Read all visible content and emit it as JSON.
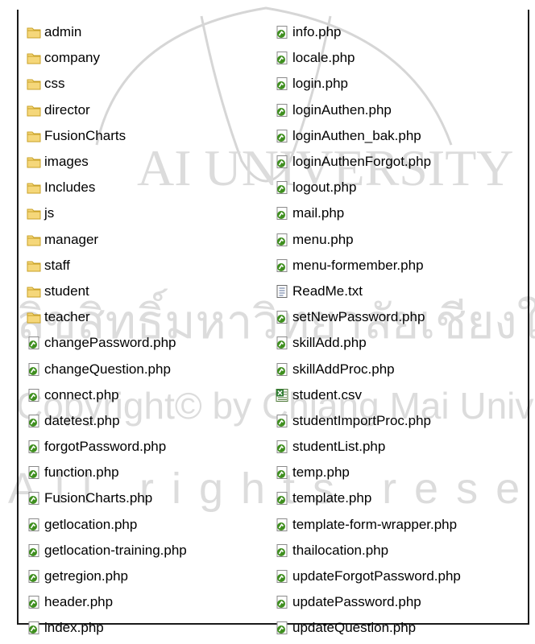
{
  "columns": [
    {
      "items": [
        {
          "name": "admin",
          "icon": "folder-icon"
        },
        {
          "name": "company",
          "icon": "folder-icon"
        },
        {
          "name": "css",
          "icon": "folder-icon"
        },
        {
          "name": "director",
          "icon": "folder-icon"
        },
        {
          "name": "FusionCharts",
          "icon": "folder-icon"
        },
        {
          "name": "images",
          "icon": "folder-icon"
        },
        {
          "name": "Includes",
          "icon": "folder-icon"
        },
        {
          "name": "js",
          "icon": "folder-icon"
        },
        {
          "name": "manager",
          "icon": "folder-icon"
        },
        {
          "name": "staff",
          "icon": "folder-icon"
        },
        {
          "name": "student",
          "icon": "folder-icon"
        },
        {
          "name": "teacher",
          "icon": "folder-icon"
        },
        {
          "name": "changePassword.php",
          "icon": "php-file-icon"
        },
        {
          "name": "changeQuestion.php",
          "icon": "php-file-icon"
        },
        {
          "name": "connect.php",
          "icon": "php-file-icon"
        },
        {
          "name": "datetest.php",
          "icon": "php-file-icon"
        },
        {
          "name": "forgotPassword.php",
          "icon": "php-file-icon"
        },
        {
          "name": "function.php",
          "icon": "php-file-icon"
        },
        {
          "name": "FusionCharts.php",
          "icon": "php-file-icon"
        },
        {
          "name": "getlocation.php",
          "icon": "php-file-icon"
        },
        {
          "name": "getlocation-training.php",
          "icon": "php-file-icon"
        },
        {
          "name": "getregion.php",
          "icon": "php-file-icon"
        },
        {
          "name": "header.php",
          "icon": "php-file-icon"
        },
        {
          "name": "index.php",
          "icon": "php-file-icon"
        }
      ]
    },
    {
      "items": [
        {
          "name": "info.php",
          "icon": "php-file-icon"
        },
        {
          "name": "locale.php",
          "icon": "php-file-icon"
        },
        {
          "name": "login.php",
          "icon": "php-file-icon"
        },
        {
          "name": "loginAuthen.php",
          "icon": "php-file-icon"
        },
        {
          "name": "loginAuthen_bak.php",
          "icon": "php-file-icon"
        },
        {
          "name": "loginAuthenForgot.php",
          "icon": "php-file-icon"
        },
        {
          "name": "logout.php",
          "icon": "php-file-icon"
        },
        {
          "name": "mail.php",
          "icon": "php-file-icon"
        },
        {
          "name": "menu.php",
          "icon": "php-file-icon"
        },
        {
          "name": "menu-formember.php",
          "icon": "php-file-icon"
        },
        {
          "name": "ReadMe.txt",
          "icon": "text-file-icon"
        },
        {
          "name": "setNewPassword.php",
          "icon": "php-file-icon"
        },
        {
          "name": "skillAdd.php",
          "icon": "php-file-icon"
        },
        {
          "name": "skillAddProc.php",
          "icon": "php-file-icon"
        },
        {
          "name": "student.csv",
          "icon": "csv-file-icon"
        },
        {
          "name": "studentImportProc.php",
          "icon": "php-file-icon"
        },
        {
          "name": "studentList.php",
          "icon": "php-file-icon"
        },
        {
          "name": "temp.php",
          "icon": "php-file-icon"
        },
        {
          "name": "template.php",
          "icon": "php-file-icon"
        },
        {
          "name": "template-form-wrapper.php",
          "icon": "php-file-icon"
        },
        {
          "name": "thailocation.php",
          "icon": "php-file-icon"
        },
        {
          "name": "updateForgotPassword.php",
          "icon": "php-file-icon"
        },
        {
          "name": "updatePassword.php",
          "icon": "php-file-icon"
        },
        {
          "name": "updateQuestion.php",
          "icon": "php-file-icon"
        }
      ]
    }
  ],
  "watermark": {
    "lines": [
      "AI UNIVERSITY",
      "ลิขสิทธิ์มหาวิทยาลัยเชียงใหม่",
      "Copyright© by Chiang Mai University",
      "All rights reserved"
    ],
    "color": "#d4d4d4"
  },
  "colors": {
    "folder_fill": "#f5d77a",
    "folder_stroke": "#c9a227",
    "php_green": "#3f8f1f",
    "border": "#1a1a1a"
  }
}
